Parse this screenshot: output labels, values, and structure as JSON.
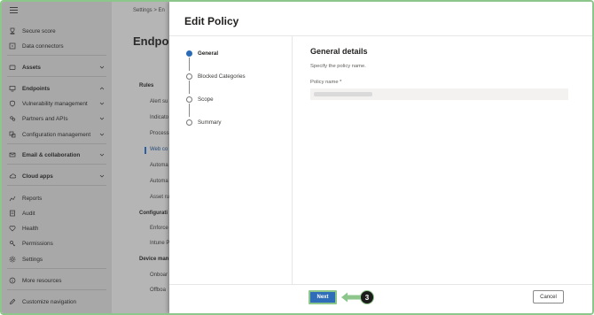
{
  "nav": {
    "items": [
      {
        "label": "Secure score",
        "icon": "trophy-icon"
      },
      {
        "label": "Data connectors",
        "icon": "connector-icon"
      },
      {
        "label": "Assets",
        "icon": "assets-icon"
      },
      {
        "label": "Endpoints",
        "icon": "endpoints-icon"
      },
      {
        "label": "Vulnerability management",
        "icon": "shield-icon"
      },
      {
        "label": "Partners and APIs",
        "icon": "partners-icon"
      },
      {
        "label": "Configuration management",
        "icon": "config-icon"
      },
      {
        "label": "Email & collaboration",
        "icon": "mail-icon"
      },
      {
        "label": "Cloud apps",
        "icon": "cloud-icon"
      },
      {
        "label": "Reports",
        "icon": "reports-icon"
      },
      {
        "label": "Audit",
        "icon": "audit-icon"
      },
      {
        "label": "Health",
        "icon": "heart-icon"
      },
      {
        "label": "Permissions",
        "icon": "key-icon"
      },
      {
        "label": "Settings",
        "icon": "gear-icon"
      },
      {
        "label": "More resources",
        "icon": "info-icon"
      },
      {
        "label": "Customize navigation",
        "icon": "pencil-icon"
      }
    ]
  },
  "background": {
    "breadcrumb": "Settings  >  En",
    "title": "Endpoi",
    "rules_heading": "Rules",
    "rules_items": [
      "Alert su",
      "Indicato",
      "Process",
      "Web co",
      "Automa",
      "Automa",
      "Asset ru"
    ],
    "config_heading": "Configurati",
    "config_items": [
      "Enforce",
      "Intune P"
    ],
    "device_heading": "Device man",
    "device_items": [
      "Onboar",
      "Offboa"
    ]
  },
  "panel": {
    "title": "Edit Policy",
    "steps": [
      "General",
      "Blocked Categories",
      "Scope",
      "Summary"
    ],
    "section_title": "General details",
    "section_desc": "Specify the policy name.",
    "field_label": "Policy name *",
    "field_value": ""
  },
  "footer": {
    "next_label": "Next",
    "cancel_label": "Cancel",
    "callout_number": "3"
  },
  "colors": {
    "accent": "#2f6db8",
    "callout_green": "#8cc68a",
    "nav_bg": "#a8a8a8"
  }
}
